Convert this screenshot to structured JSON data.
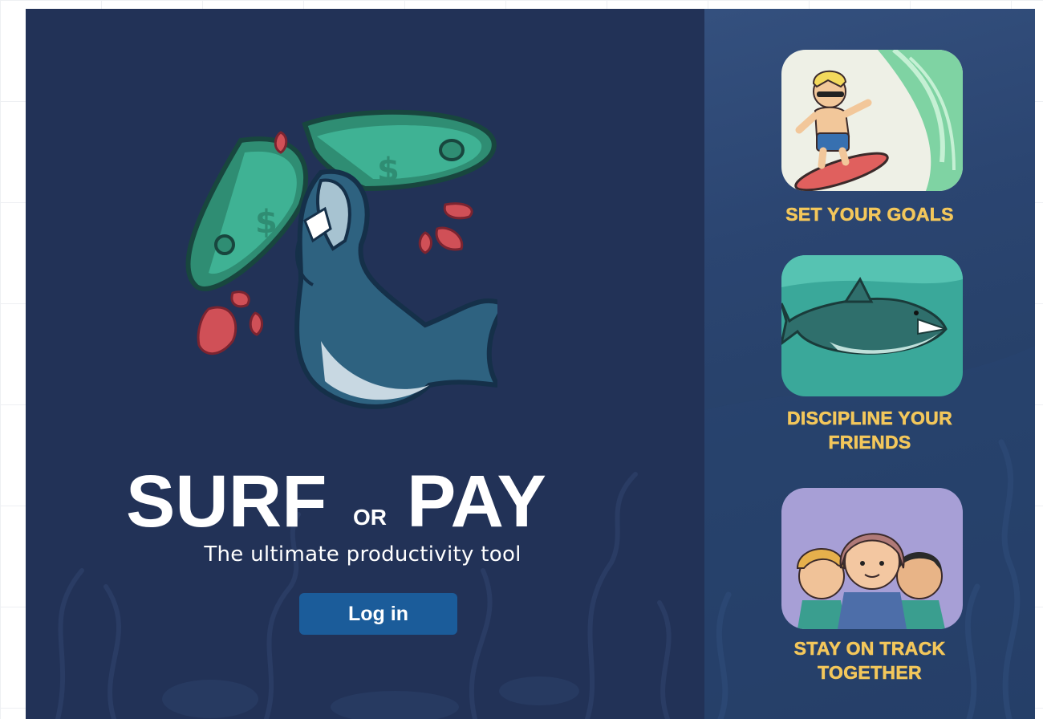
{
  "brand": {
    "word1": "SURF",
    "connector": "OR",
    "word2": "PAY",
    "tagline": "The ultimate productivity tool"
  },
  "login": {
    "label": "Log in"
  },
  "features": [
    {
      "label": "Set your goals",
      "icon": "surfer-illustration"
    },
    {
      "label": "Discipline your friends",
      "icon": "shark-illustration"
    },
    {
      "label": "Stay on track together",
      "icon": "friends-group-illustration"
    }
  ],
  "colors": {
    "main_bg": "#223257",
    "side_bg": "#2b4571",
    "accent_label": "#f3c75b",
    "button_bg": "#1b5c9a",
    "title_text": "#ffffff"
  }
}
